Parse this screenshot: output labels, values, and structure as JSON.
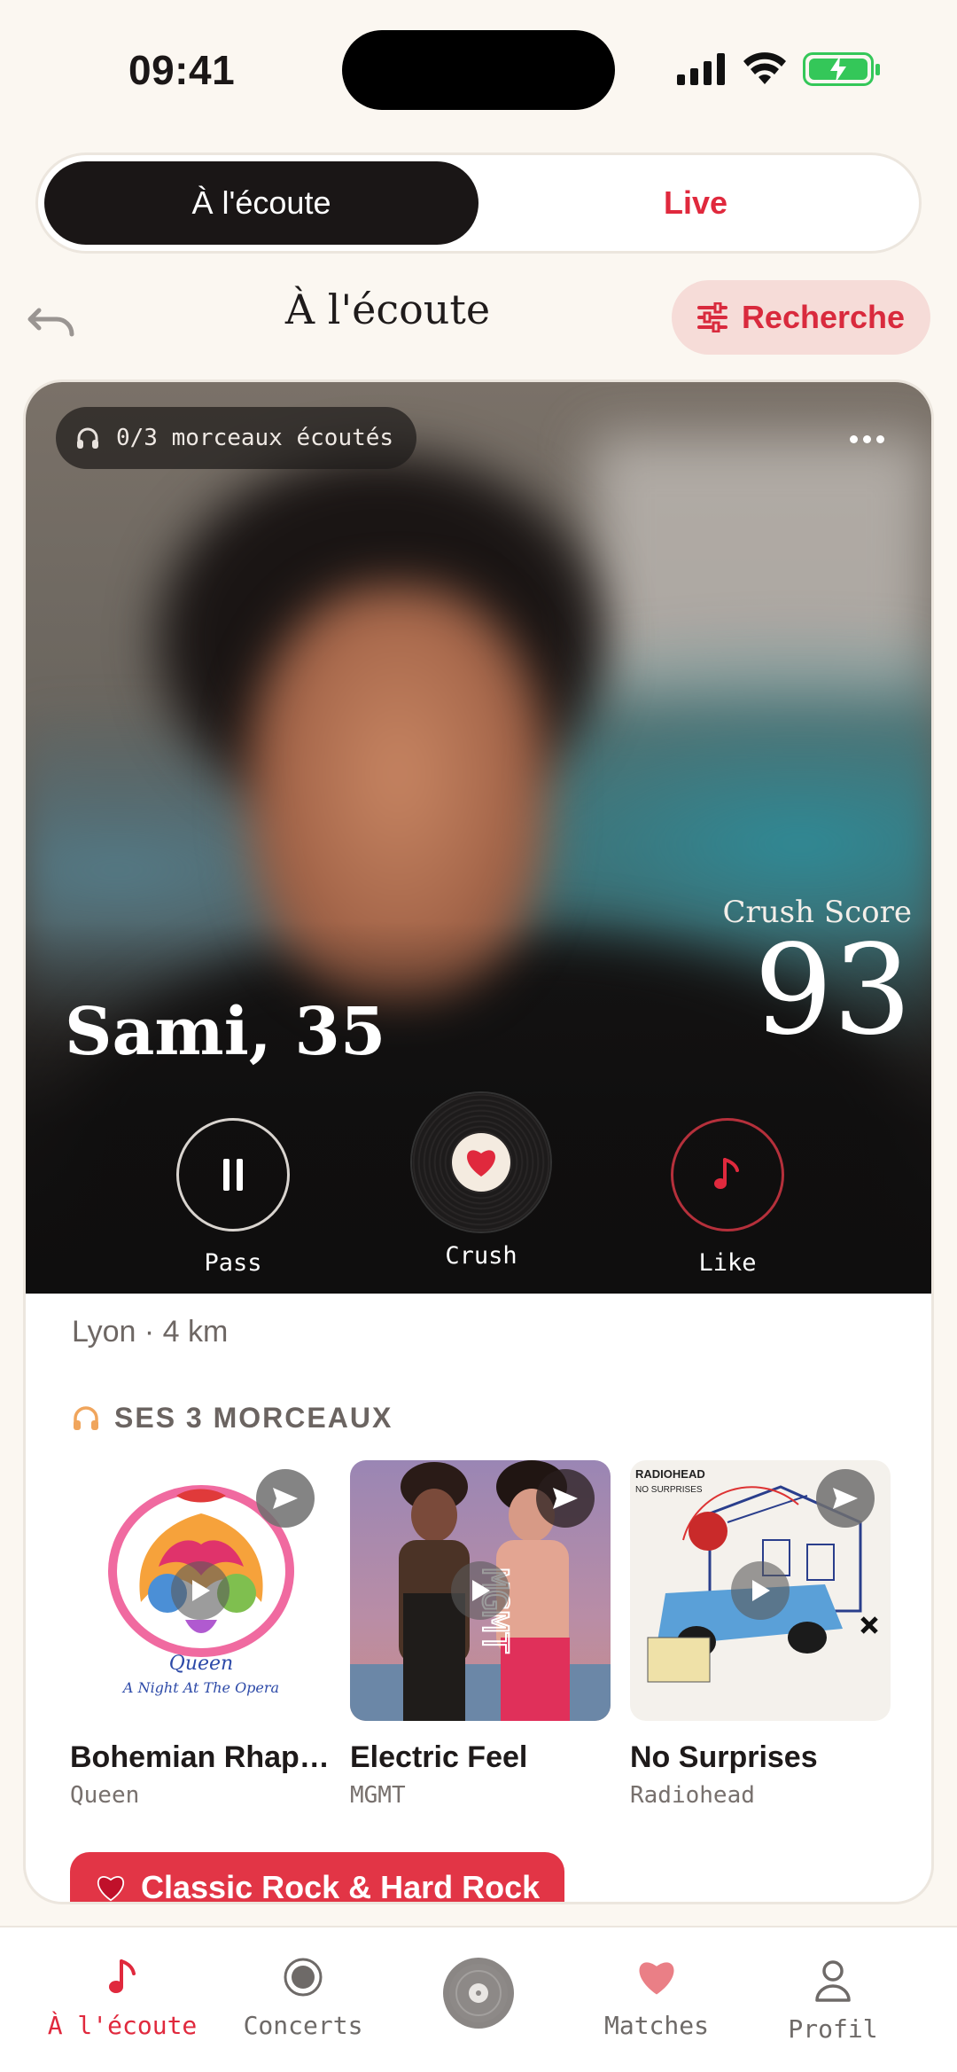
{
  "status": {
    "time": "09:41"
  },
  "segmented": {
    "active_label": "À l'écoute",
    "other_label": "Live"
  },
  "header": {
    "title": "À l'écoute",
    "search_label": "Recherche"
  },
  "profile": {
    "listened": "0/3 morceaux écoutés",
    "crush_score_label": "Crush Score",
    "crush_score": "93",
    "name_age": "Sami, 35",
    "location": "Lyon · 4 km"
  },
  "actions": {
    "pass": "Pass",
    "crush": "Crush",
    "like": "Like"
  },
  "tracks_section": {
    "title": "SES 3 MORCEAUX",
    "tracks": [
      {
        "title": "Bohemian Rhap…",
        "artist": "Queen",
        "cover_text_1": "Queen",
        "cover_text_2": "A Night At The Opera"
      },
      {
        "title": "Electric Feel",
        "artist": "MGMT",
        "cover_text_1": "MGMT"
      },
      {
        "title": "No Surprises",
        "artist": "Radiohead",
        "cover_text_1": "RADIOHEAD",
        "cover_text_2": "NO SURPRISES"
      }
    ]
  },
  "genre_chip": "Classic Rock & Hard Rock",
  "tabbar": {
    "listen": "À l'écoute",
    "concerts": "Concerts",
    "matches": "Matches",
    "profile": "Profil"
  },
  "colors": {
    "accent": "#e0293d",
    "background": "#fbf7f1",
    "dark": "#1a1616"
  }
}
